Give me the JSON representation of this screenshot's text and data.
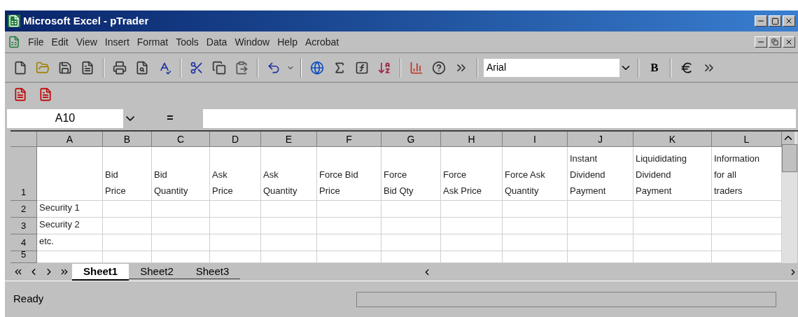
{
  "window": {
    "title": "Microsoft Excel - pTrader"
  },
  "menu": [
    "File",
    "Edit",
    "View",
    "Insert",
    "Format",
    "Tools",
    "Data",
    "Window",
    "Help",
    "Acrobat"
  ],
  "toolbar": {
    "font": "Arial",
    "bold": "B"
  },
  "formula_bar": {
    "name_box": "A10",
    "equals": "="
  },
  "sheet": {
    "columns": [
      "A",
      "B",
      "C",
      "D",
      "E",
      "F",
      "G",
      "H",
      "I",
      "J",
      "K",
      "L"
    ],
    "rows": [
      {
        "number": "1",
        "cells": [
          "",
          "Bid\nPrice",
          "Bid\nQuantity",
          "Ask\nPrice",
          "Ask\nQuantity",
          "Force Bid\nPrice",
          "Force\nBid Qty",
          "Force\nAsk Price",
          "Force Ask\nQuantity",
          "Instant\nDividend\nPayment",
          "Liquididating\nDividend\nPayment",
          "Information\nfor all\ntraders"
        ]
      },
      {
        "number": "2",
        "cells": [
          "Security 1",
          "",
          "",
          "",
          "",
          "",
          "",
          "",
          "",
          "",
          "",
          ""
        ]
      },
      {
        "number": "3",
        "cells": [
          "Security 2",
          "",
          "",
          "",
          "",
          "",
          "",
          "",
          "",
          "",
          "",
          ""
        ]
      },
      {
        "number": "4",
        "cells": [
          "etc.",
          "",
          "",
          "",
          "",
          "",
          "",
          "",
          "",
          "",
          "",
          ""
        ]
      },
      {
        "number": "5",
        "cells": [
          "",
          "",
          "",
          "",
          "",
          "",
          "",
          "",
          "",
          "",
          "",
          ""
        ]
      }
    ]
  },
  "tabs": [
    {
      "label": "Sheet1",
      "selected": true
    },
    {
      "label": "Sheet2",
      "selected": false
    },
    {
      "label": "Sheet3",
      "selected": false
    }
  ],
  "status_bar": {
    "text": "Ready"
  }
}
